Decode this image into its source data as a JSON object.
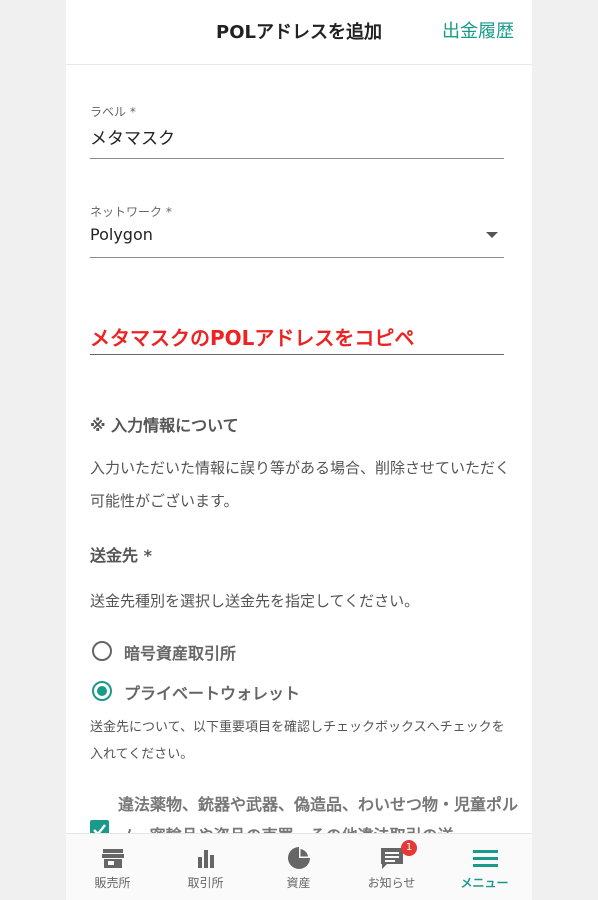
{
  "header": {
    "title": "POLアドレスを追加",
    "link": "出金履歴"
  },
  "form": {
    "label_field": {
      "label": "ラベル *",
      "value": "メタマスク"
    },
    "network_field": {
      "label": "ネットワーク *",
      "value": "Polygon"
    },
    "address_note": "メタマスクのPOLアドレスをコピペ"
  },
  "info": {
    "title": "※ 入力情報について",
    "text": "入力いただいた情報に誤り等がある場合、削除させていただく可能性がございます。"
  },
  "destination": {
    "title": "送金先 *",
    "text": "送金先種別を選択し送金先を指定してください。",
    "options": [
      {
        "label": "暗号資産取引所",
        "checked": false
      },
      {
        "label": "プライベートウォレット",
        "checked": true
      }
    ],
    "instruction": "送金先について、以下重要項目を確認しチェックボックスへチェックを入れてください。",
    "check_item": "違法薬物、銃器や武器、偽造品、わいせつ物・児童ポルノ、密輸品や盗品の売買、その他違法取引の送"
  },
  "nav": {
    "items": [
      {
        "label": "販売所",
        "icon": "store-icon"
      },
      {
        "label": "取引所",
        "icon": "bar-chart-icon"
      },
      {
        "label": "資産",
        "icon": "pie-chart-icon"
      },
      {
        "label": "お知らせ",
        "icon": "message-icon",
        "badge": "1"
      },
      {
        "label": "メニュー",
        "icon": "menu-icon",
        "active": true
      }
    ]
  },
  "colors": {
    "accent": "#1a9b8a",
    "annotation": "#ee2222",
    "badge": "#e53935"
  }
}
